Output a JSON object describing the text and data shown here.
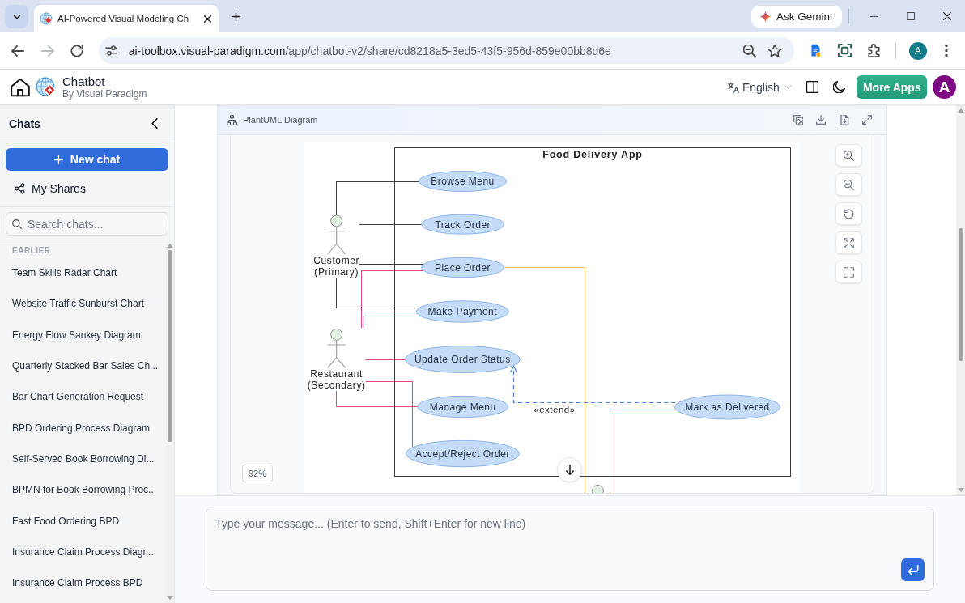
{
  "browser": {
    "tabs": [
      {
        "title": "AI-Powered Visual Modeling Ch",
        "selected": true
      }
    ],
    "ask_gemini_button": "Ask Gemini",
    "nav_buttons": [
      {
        "kind": "back",
        "disabled": false
      },
      {
        "kind": "forward",
        "disabled": true
      },
      {
        "kind": "reload",
        "disabled": false
      }
    ],
    "address": {
      "host": "ai-toolbox.visual-paradigm.com",
      "path": "/app/chatbot-v2/share/cd8218a5-3ed5-43f5-956d-859e00bb8d6e"
    },
    "profile_initial": "A"
  },
  "header": {
    "app_name": "Chatbot",
    "app_subtitle": "By Visual Paradigm",
    "language": "English",
    "more_apps_button": "More Apps",
    "avatar_initial": "A"
  },
  "sidebar": {
    "title": "Chats",
    "new_chat_button": "New chat",
    "my_shares": "My Shares",
    "search": {
      "placeholder": "Search chats..."
    },
    "section_label": "EARLIER",
    "chats": [
      {
        "label": "Team Skills Radar Chart",
        "selected": false
      },
      {
        "label": "Website Traffic Sunburst Chart",
        "selected": false
      },
      {
        "label": "Energy Flow Sankey Diagram",
        "selected": false
      },
      {
        "label": "Quarterly Stacked Bar Sales Ch...",
        "selected": false
      },
      {
        "label": "Bar Chart Generation Request",
        "selected": false
      },
      {
        "label": "BPD Ordering Process Diagram",
        "selected": false
      },
      {
        "label": "Self-Served Book Borrowing Di...",
        "selected": false
      },
      {
        "label": "BPMN for Book Borrowing Proc...",
        "selected": false
      },
      {
        "label": "Fast Food Ordering BPD",
        "selected": false
      },
      {
        "label": "Insurance Claim Process Diagr...",
        "selected": false
      },
      {
        "label": "Insurance Claim Process BPD",
        "selected": false
      }
    ]
  },
  "diagram_panel": {
    "title": "PlantUML Diagram",
    "zoom_level": "92%",
    "diagram": {
      "system_title": "Food Delivery App",
      "actors": [
        {
          "name": "Customer",
          "role": "(Primary)",
          "color": "#3c3c3c"
        },
        {
          "name": "Restaurant",
          "role": "(Secondary)",
          "color": "#e2457a"
        },
        {
          "color": "#eebf55"
        }
      ],
      "use_cases": [
        {
          "label": "Browse Menu"
        },
        {
          "label": "Track Order"
        },
        {
          "label": "Place Order"
        },
        {
          "label": "Make Payment"
        },
        {
          "label": "Update Order Status"
        },
        {
          "label": "Manage Menu"
        },
        {
          "label": "Accept/Reject Order"
        },
        {
          "label": "Mark as Delivered"
        }
      ],
      "extend": {
        "label": "«extend»"
      }
    }
  },
  "composer": {
    "placeholder": "Type your message... (Enter to send, Shift+Enter for new line)"
  }
}
